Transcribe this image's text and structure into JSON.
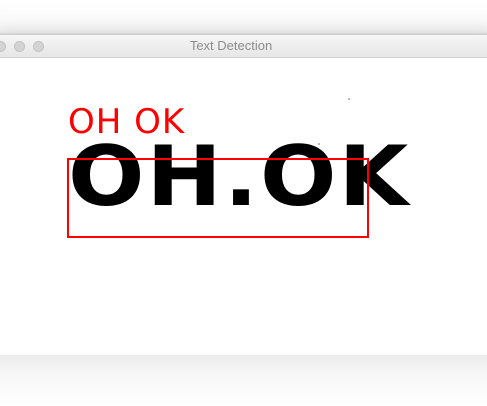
{
  "window": {
    "title": "Text Detection"
  },
  "image": {
    "handwritten_text": "OH.OK"
  },
  "detection": {
    "label": "OH OK",
    "color": "#ff0000"
  }
}
